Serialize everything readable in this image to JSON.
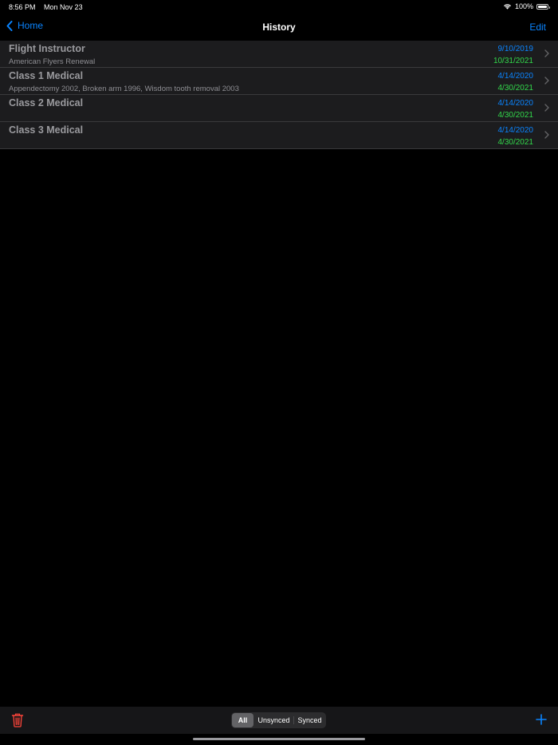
{
  "status_bar": {
    "time": "8:56 PM",
    "date": "Mon Nov 23",
    "battery": "100%",
    "wifi_icon": "wifi-icon",
    "battery_icon": "battery-icon"
  },
  "nav": {
    "back_label": "Home",
    "title": "History",
    "edit_label": "Edit"
  },
  "rows": [
    {
      "title": "Flight Instructor",
      "subtitle": "American Flyers Renewal",
      "date1": "9/10/2019",
      "date2": "10/31/2021"
    },
    {
      "title": "Class 1 Medical",
      "subtitle": "Appendectomy 2002, Broken arm 1996, Wisdom tooth removal 2003",
      "date1": "4/14/2020",
      "date2": "4/30/2021"
    },
    {
      "title": "Class 2 Medical",
      "subtitle": "",
      "date1": "4/14/2020",
      "date2": "4/30/2021"
    },
    {
      "title": "Class 3 Medical",
      "subtitle": "",
      "date1": "4/14/2020",
      "date2": "4/30/2021"
    }
  ],
  "toolbar": {
    "segments": [
      "All",
      "Unsynced",
      "Synced"
    ],
    "selected_segment": "All",
    "trash_icon": "trash-icon",
    "add_icon": "plus-icon"
  },
  "colors": {
    "accent": "#0a84ff",
    "date_green": "#32d74b",
    "destructive": "#ff453a",
    "row_background": "#1c1c1e"
  }
}
